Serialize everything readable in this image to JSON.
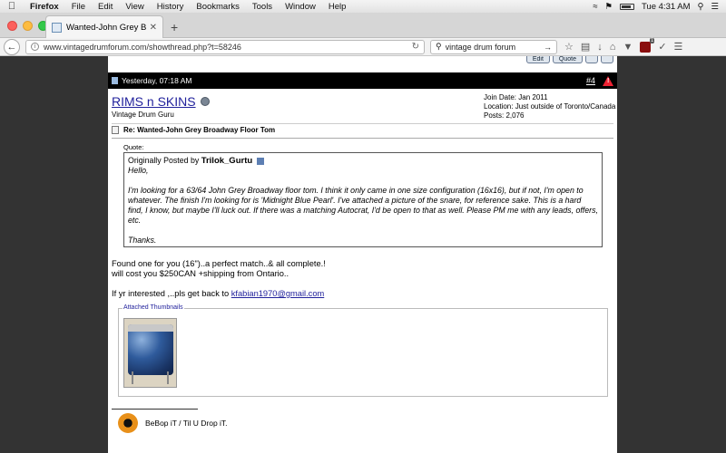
{
  "menubar": {
    "app": "Firefox",
    "items": [
      "File",
      "Edit",
      "View",
      "History",
      "Bookmarks",
      "Tools",
      "Window",
      "Help"
    ],
    "clock": "Tue 4:31 AM"
  },
  "tab": {
    "title": "Wanted-John Grey Broadw..."
  },
  "nav": {
    "url": "www.vintagedrumforum.com/showthread.php?t=58246",
    "search": "vintage drum forum",
    "ublock_count": "1"
  },
  "post": {
    "buttons": {
      "edit": "Edit",
      "quote": "Quote"
    },
    "timestamp": "Yesterday, 07:18 AM",
    "number": "#4",
    "username": "RIMS n SKINS",
    "user_title": "Vintage Drum Guru",
    "join_date": "Join Date: Jan 2011",
    "location": "Location: Just outside of Toronto/Canada",
    "posts": "Posts: 2,076",
    "title": "Re: Wanted-John Grey Broadway Floor Tom",
    "quote_label": "Quote:",
    "quote_prefix": "Originally Posted by",
    "quote_author": "Trilok_Gurtu",
    "quote_lines": [
      "Hello,",
      "I'm looking for a 63/64 John Grey Broadway floor tom. I think it only came in one size configuration (16x16), but if not, I'm open to whatever. The finish I'm looking for is 'Midnight Blue Pearl'. I've attached a picture of the snare, for reference sake. This is a hard find, I know, but maybe I'll luck out. If there was a matching Autocrat, I'd be open to that as well. Please PM me with any leads, offers, etc.",
      "Thanks."
    ],
    "body_line1": "Found one for you (16\")..a perfect match..& all complete.!",
    "body_line2": "will cost you $250CAN +shipping from Ontario..",
    "body_line3_prefix": "If yr interested ,..pls get back to ",
    "email": "kfabian1970@gmail.com",
    "attachments_label": "Attached Thumbnails",
    "signature": "BeBop iT / Til U Drop iT."
  }
}
